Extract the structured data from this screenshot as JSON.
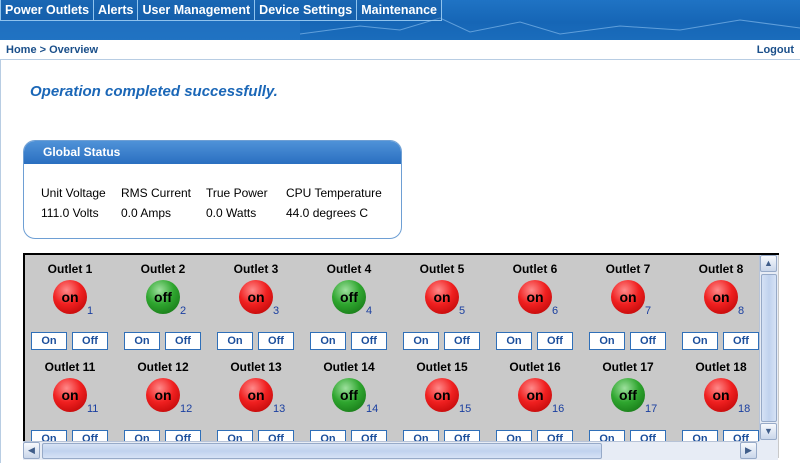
{
  "nav": {
    "tabs": [
      "Power Outlets",
      "Alerts",
      "User Management",
      "Device Settings",
      "Maintenance"
    ]
  },
  "breadcrumb": {
    "home": "Home",
    "separator": ">",
    "current": "Overview"
  },
  "logout": "Logout",
  "message": "Operation completed successfully.",
  "global_status": {
    "title": "Global Status",
    "headers": [
      "Unit Voltage",
      "RMS Current",
      "True Power",
      "CPU Temperature"
    ],
    "values": [
      "111.0 Volts",
      "0.0 Amps",
      "0.0 Watts",
      "44.0 degrees C"
    ]
  },
  "outlet_buttons": {
    "on": "On",
    "off": "Off"
  },
  "outlets": [
    {
      "name": "Outlet 1",
      "state": "on",
      "num": "1"
    },
    {
      "name": "Outlet 2",
      "state": "off",
      "num": "2"
    },
    {
      "name": "Outlet 3",
      "state": "on",
      "num": "3"
    },
    {
      "name": "Outlet 4",
      "state": "off",
      "num": "4"
    },
    {
      "name": "Outlet 5",
      "state": "on",
      "num": "5"
    },
    {
      "name": "Outlet 6",
      "state": "on",
      "num": "6"
    },
    {
      "name": "Outlet 7",
      "state": "on",
      "num": "7"
    },
    {
      "name": "Outlet 8",
      "state": "on",
      "num": "8"
    },
    {
      "name": "Outlet 11",
      "state": "on",
      "num": "11"
    },
    {
      "name": "Outlet 12",
      "state": "on",
      "num": "12"
    },
    {
      "name": "Outlet 13",
      "state": "on",
      "num": "13"
    },
    {
      "name": "Outlet 14",
      "state": "off",
      "num": "14"
    },
    {
      "name": "Outlet 15",
      "state": "on",
      "num": "15"
    },
    {
      "name": "Outlet 16",
      "state": "on",
      "num": "16"
    },
    {
      "name": "Outlet 17",
      "state": "off",
      "num": "17"
    },
    {
      "name": "Outlet 18",
      "state": "on",
      "num": "18"
    }
  ],
  "colors": {
    "nav_blue": "#1a6cbb",
    "message_blue": "#1b67b7",
    "on_red": "#f02020",
    "off_green": "#2fa62f"
  },
  "icons": {
    "scroll_up": "scroll-up-arrow-icon",
    "scroll_down": "scroll-down-arrow-icon",
    "scroll_left": "scroll-left-arrow-icon",
    "scroll_right": "scroll-right-arrow-icon"
  }
}
